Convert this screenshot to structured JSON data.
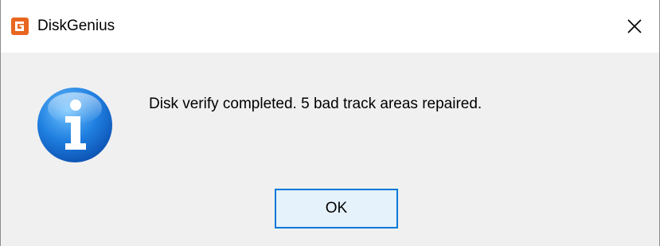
{
  "window": {
    "title": "DiskGenius",
    "app_icon": "diskgenius-logo-icon",
    "close_icon": "close-icon"
  },
  "dialog": {
    "icon": "information-icon",
    "message": "Disk verify completed. 5 bad track areas repaired.",
    "ok_label": "OK"
  },
  "colors": {
    "accent": "#0078d7",
    "button_bg": "#e5f1fb",
    "app_icon_orange": "#e8661f",
    "info_blue": "#1f7fe0"
  }
}
